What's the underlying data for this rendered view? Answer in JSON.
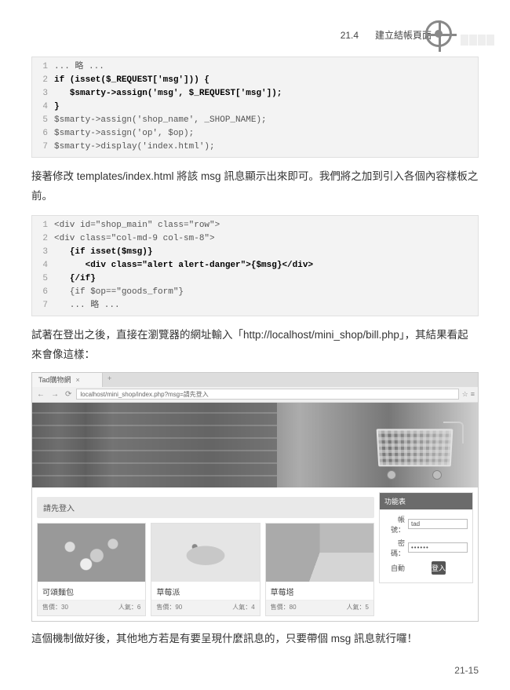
{
  "header": {
    "section": "21.4",
    "title": "建立結帳頁面"
  },
  "code1": {
    "lines": [
      {
        "n": "1",
        "t": "... 略 ..."
      },
      {
        "n": "2",
        "t": "<b>if (isset($_REQUEST['msg'])) {</b>"
      },
      {
        "n": "3",
        "t": "   <b>$smarty->assign('msg', $_REQUEST['msg']);</b>"
      },
      {
        "n": "4",
        "t": "<b>}</b>"
      },
      {
        "n": "5",
        "t": "$smarty->assign('shop_name', _SHOP_NAME);"
      },
      {
        "n": "6",
        "t": "$smarty->assign('op', $op);"
      },
      {
        "n": "7",
        "t": "$smarty->display('index.html');"
      }
    ]
  },
  "para1": "接著修改 templates/index.html 將該 msg 訊息顯示出來即可。我們將之加到引入各個內容樣板之前。",
  "code2": {
    "lines": [
      {
        "n": "1",
        "t": "&lt;div id=\"shop_main\" class=\"row\"&gt;"
      },
      {
        "n": "2",
        "t": "&lt;div class=\"col-md-9 col-sm-8\"&gt;"
      },
      {
        "n": "3",
        "t": "   <b>{if isset($msg)}</b>"
      },
      {
        "n": "4",
        "t": "      <b>&lt;div class=\"alert alert-danger\"&gt;{$msg}&lt;/div&gt;</b>"
      },
      {
        "n": "5",
        "t": "   <b>{/if}</b>"
      },
      {
        "n": "6",
        "t": "   {if $op==\"goods_form\"}"
      },
      {
        "n": "7",
        "t": "   ... 略 ..."
      }
    ]
  },
  "para2": "試著在登出之後，直接在瀏覽器的網址輸入「http://localhost/mini_shop/bill.php」，其結果看起來會像這樣：",
  "browser": {
    "tab_title": "Tad購物網",
    "url": "localhost/mini_shop/index.php?msg=請先登入",
    "alert": "請先登入",
    "sidebar_title": "功能表",
    "form": {
      "user_label": "帳號：",
      "user_value": "tad",
      "pass_label": "密碼：",
      "pass_value": "••••••",
      "auto_label": "自動",
      "login_btn": "登入"
    },
    "products": [
      {
        "name": "可頌麵包",
        "price": "售價：30",
        "qty": "人氣：6"
      },
      {
        "name": "草莓派",
        "price": "售價：90",
        "qty": "人氣：4"
      },
      {
        "name": "草莓塔",
        "price": "售價：80",
        "qty": "人氣：5"
      }
    ]
  },
  "para3": "這個機制做好後，其他地方若是有要呈現什麼訊息的，只要帶個 msg 訊息就行囉！",
  "pagenum": "21-15"
}
